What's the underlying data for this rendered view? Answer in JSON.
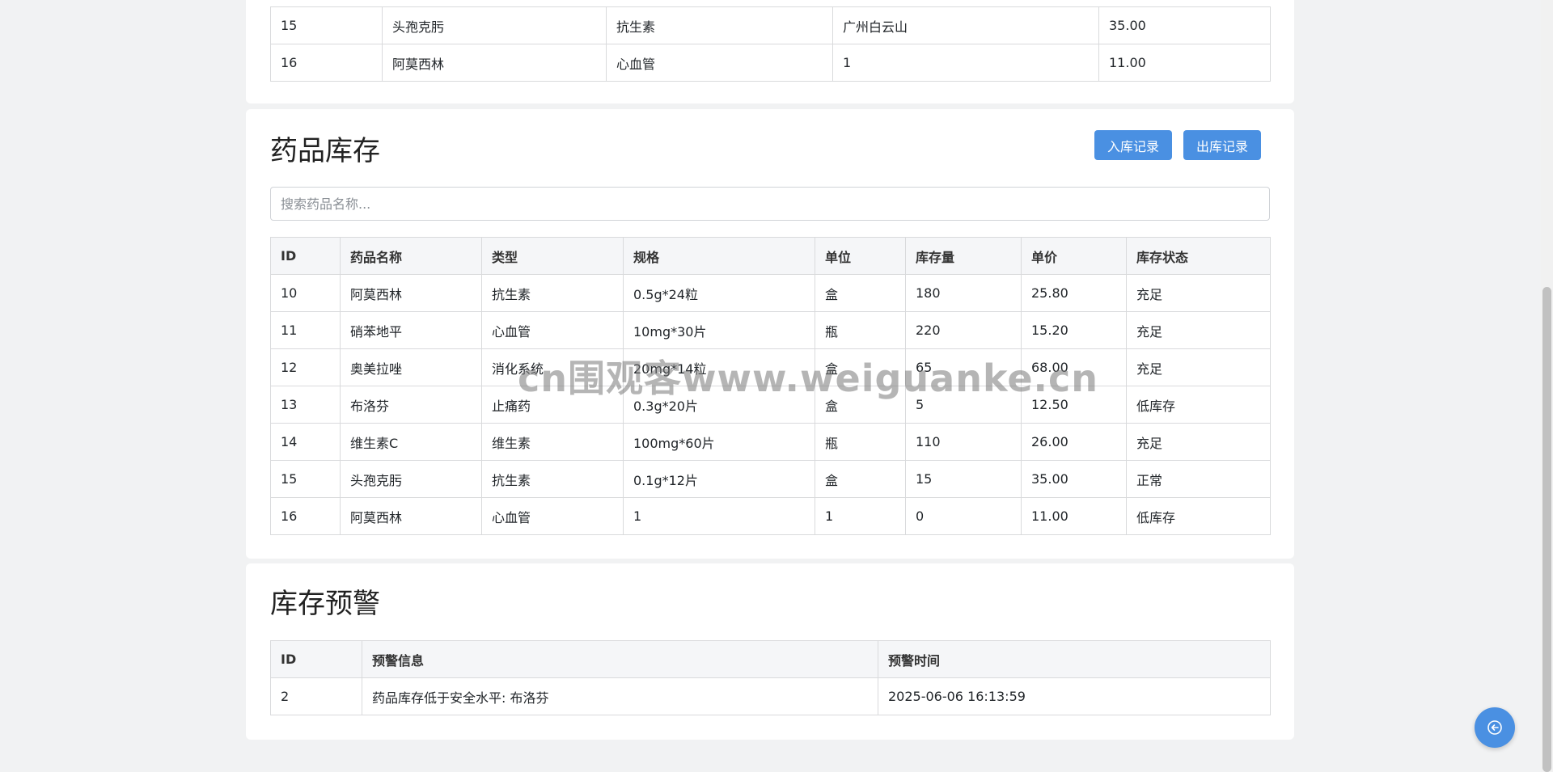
{
  "top_table": {
    "rows": [
      [
        "15",
        "头孢克肟",
        "抗生素",
        "广州白云山",
        "35.00"
      ],
      [
        "16",
        "阿莫西林",
        "心血管",
        "1",
        "11.00"
      ]
    ]
  },
  "inventory": {
    "title": "药品库存",
    "buttons": {
      "in_records": "入库记录",
      "out_records": "出库记录"
    },
    "search_placeholder": "搜索药品名称...",
    "headers": [
      "ID",
      "药品名称",
      "类型",
      "规格",
      "单位",
      "库存量",
      "单价",
      "库存状态"
    ],
    "rows": [
      [
        "10",
        "阿莫西林",
        "抗生素",
        "0.5g*24粒",
        "盒",
        "180",
        "25.80",
        "充足"
      ],
      [
        "11",
        "硝苯地平",
        "心血管",
        "10mg*30片",
        "瓶",
        "220",
        "15.20",
        "充足"
      ],
      [
        "12",
        "奥美拉唑",
        "消化系统",
        "20mg*14粒",
        "盒",
        "65",
        "68.00",
        "充足"
      ],
      [
        "13",
        "布洛芬",
        "止痛药",
        "0.3g*20片",
        "盒",
        "5",
        "12.50",
        "低库存"
      ],
      [
        "14",
        "维生素C",
        "维生素",
        "100mg*60片",
        "瓶",
        "110",
        "26.00",
        "充足"
      ],
      [
        "15",
        "头孢克肟",
        "抗生素",
        "0.1g*12片",
        "盒",
        "15",
        "35.00",
        "正常"
      ],
      [
        "16",
        "阿莫西林",
        "心血管",
        "1",
        "1",
        "0",
        "11.00",
        "低库存"
      ]
    ]
  },
  "alerts": {
    "title": "库存预警",
    "headers": [
      "ID",
      "预警信息",
      "预警时间"
    ],
    "rows": [
      [
        "2",
        "药品库存低于安全水平: 布洛芬",
        "2025-06-06 16:13:59"
      ]
    ]
  },
  "watermark": "cn围观客www.weiguanke.cn",
  "icons": {
    "fab": "arrow-left-circle-icon"
  },
  "colors": {
    "accent": "#4a90e2",
    "background": "#f1f2f3"
  }
}
